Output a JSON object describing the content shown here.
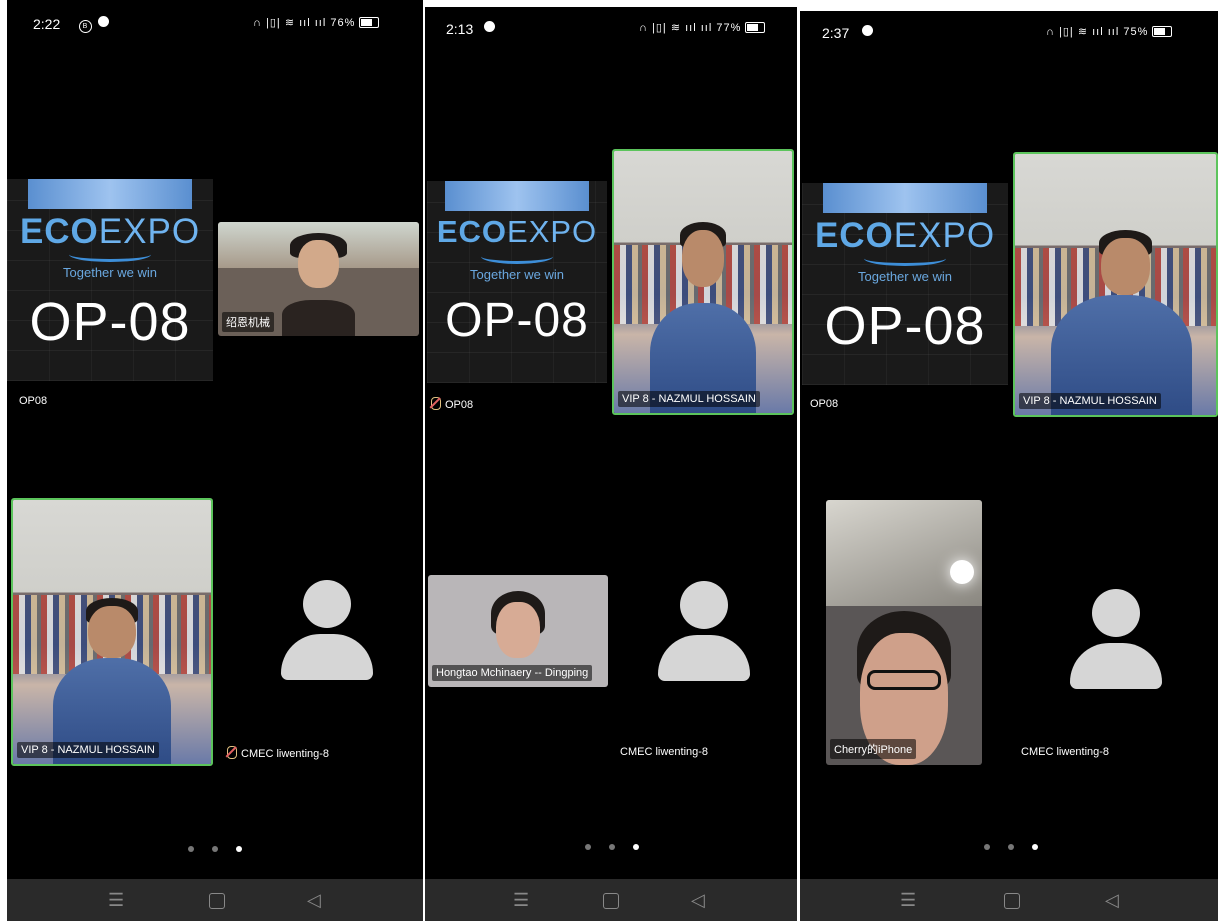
{
  "screens": [
    {
      "time": "2:22",
      "battery": "76%",
      "eco_card": {
        "brand_bold": "ECO",
        "brand_rest": "EXPO",
        "tagline": "Together we win",
        "code": "OP-08",
        "caption": "OP08"
      },
      "tile2_label": "绍恩机械",
      "tile3_label": "VIP 8 - NAZMUL HOSSAIN",
      "tile4_label": "CMEC liwenting-8"
    },
    {
      "time": "2:13",
      "battery": "77%",
      "eco_card": {
        "brand_bold": "ECO",
        "brand_rest": "EXPO",
        "tagline": "Together we win",
        "code": "OP-08",
        "caption": "OP08"
      },
      "tile2_label": "VIP 8 - NAZMUL HOSSAIN",
      "tile3_label": "Hongtao Mchinaery -- Dingping",
      "tile4_label": "CMEC liwenting-8"
    },
    {
      "time": "2:37",
      "battery": "75%",
      "eco_card": {
        "brand_bold": "ECO",
        "brand_rest": "EXPO",
        "tagline": "Together we win",
        "code": "OP-08",
        "caption": "OP08"
      },
      "tile2_label": "VIP 8 - NAZMUL HOSSAIN",
      "tile3_label": "Cherry的iPhone",
      "tile4_label": "CMEC liwenting-8"
    }
  ],
  "status_icons": {
    "signal": "ııl",
    "wifi": "≋"
  },
  "nav": {
    "menu_glyph": "☰",
    "back_glyph": "◁"
  }
}
